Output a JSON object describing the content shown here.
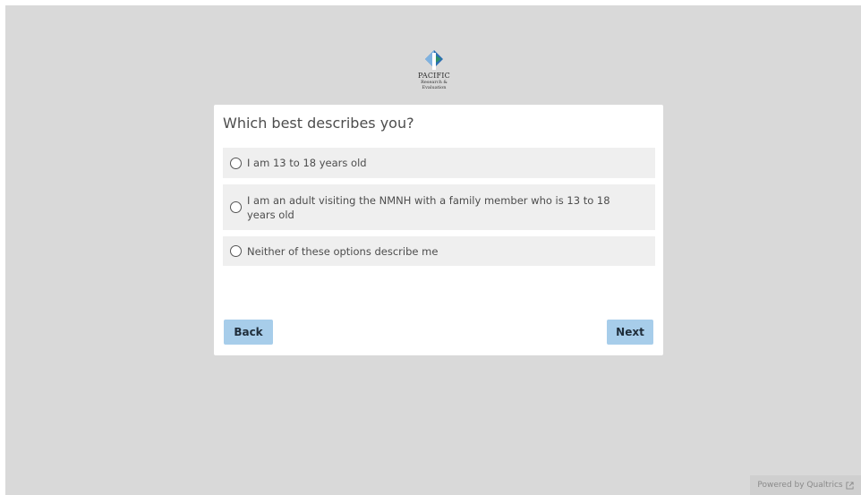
{
  "logo": {
    "brand": "PACIFIC",
    "line1": "Research &",
    "line2": "Evaluation",
    "icon": "pacific-logo-icon"
  },
  "survey": {
    "question": "Which best describes you?",
    "choices": [
      {
        "label": "I am 13 to 18 years old",
        "selected": false
      },
      {
        "label": "I am an adult visiting the NMNH with a family member who is 13 to 18 years old",
        "selected": false
      },
      {
        "label": "Neither of these options describe me",
        "selected": false
      }
    ]
  },
  "nav": {
    "back_label": "Back",
    "next_label": "Next"
  },
  "footer": {
    "powered_by": "Powered by Qualtrics",
    "external_icon": "external-link-icon"
  },
  "colors": {
    "background": "#d9d9d9",
    "card": "#ffffff",
    "choice_bg": "#efefef",
    "button": "#a7cdea"
  }
}
